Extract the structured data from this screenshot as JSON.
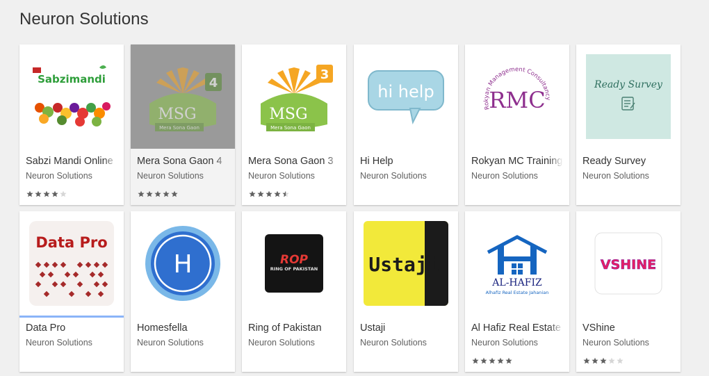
{
  "page": {
    "title": "Neuron Solutions"
  },
  "colors": {
    "star_filled": "#616161",
    "star_empty": "#d6d6d6",
    "selected_underline": "#8ab4f8"
  },
  "apps": [
    {
      "title": "Sabzi Mandi Online",
      "developer": "Neuron Solutions",
      "rating": 4,
      "icon": "sabzimandi-logo",
      "logo_text": "Sabzimandi"
    },
    {
      "title": "Mera Sona Gaon 4",
      "developer": "Neuron Solutions",
      "rating": 5,
      "icon": "msg4-logo",
      "logo_text": "MSG",
      "logo_sub": "Mera Sona Gaon",
      "logo_number": "4"
    },
    {
      "title": "Mera Sona Gaon 3",
      "developer": "Neuron Solutions",
      "rating": 4.5,
      "icon": "msg3-logo",
      "logo_text": "MSG",
      "logo_sub": "Mera Sona Gaon",
      "logo_number": "3"
    },
    {
      "title": "Hi Help",
      "developer": "Neuron Solutions",
      "rating": null,
      "icon": "hi-help-bubble",
      "logo_text": "hi help"
    },
    {
      "title": "Rokyan MC Training",
      "developer": "Neuron Solutions",
      "rating": null,
      "icon": "rmc-logo",
      "logo_text": "RMC",
      "logo_ring": "Rokyan Management Consultancy"
    },
    {
      "title": "Ready Survey",
      "developer": "Neuron Solutions",
      "rating": null,
      "icon": "ready-survey-logo",
      "logo_text": "Ready Survey"
    },
    {
      "title": "Data Pro",
      "developer": "Neuron Solutions",
      "rating": null,
      "icon": "data-pro-logo",
      "logo_text": "Data Pro"
    },
    {
      "title": "Homesfella",
      "developer": "Neuron Solutions",
      "rating": null,
      "icon": "homesfella-logo",
      "logo_text": "H"
    },
    {
      "title": "Ring of Pakistan",
      "developer": "Neuron Solutions",
      "rating": null,
      "icon": "rop-logo",
      "logo_text": "ROP",
      "logo_sub": "RING OF PAKISTAN"
    },
    {
      "title": "Ustaji",
      "developer": "Neuron Solutions",
      "rating": null,
      "icon": "ustaji-logo",
      "logo_text": "Ustaji"
    },
    {
      "title": "Al Hafiz Real Estate",
      "developer": "Neuron Solutions",
      "rating": 5,
      "icon": "al-hafiz-logo",
      "logo_text": "AL-HAFIZ",
      "logo_sub": "Alhafiz Real Estate Jahanian"
    },
    {
      "title": "VShine",
      "developer": "Neuron Solutions",
      "rating": 3,
      "icon": "vshine-logo",
      "logo_text": "VSHINE"
    }
  ]
}
